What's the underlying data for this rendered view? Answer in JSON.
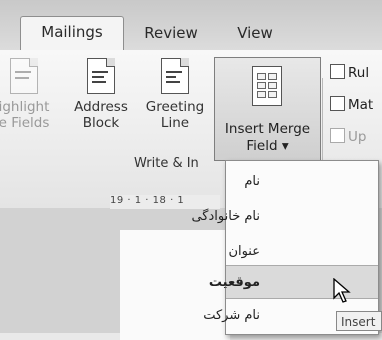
{
  "tabs": [
    "Mailings",
    "Review",
    "View"
  ],
  "ribbon": {
    "buttons": [
      {
        "line1": "ighlight",
        "line2": "e Fields"
      },
      {
        "line1": "Address",
        "line2": "Block"
      },
      {
        "line1": "Greeting",
        "line2": "Line"
      }
    ],
    "merge_button": {
      "line1": "Insert Merge",
      "line2": "Field ▾"
    },
    "group_label": "Write & In",
    "right_items": [
      "Rul",
      "Mat",
      "Up"
    ]
  },
  "ruler_text": "19 · 1 · 18 · 1",
  "dropdown_items": [
    "نام",
    "نام خانوادگی",
    "عنوان",
    "موقعیت",
    "نام شرکت"
  ],
  "tooltip": "Insert"
}
